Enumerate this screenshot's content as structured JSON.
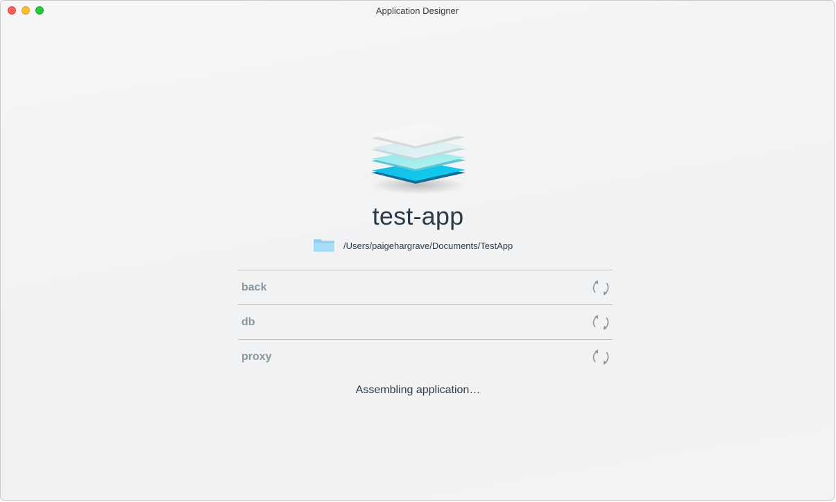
{
  "window": {
    "title": "Application Designer"
  },
  "app": {
    "name": "test-app",
    "path": "/Users/paigehargrave/Documents/TestApp",
    "icon": "layers-stack-icon",
    "folder_icon": "folder-icon"
  },
  "services": [
    {
      "name": "back",
      "icon": "refresh-icon"
    },
    {
      "name": "db",
      "icon": "refresh-icon"
    },
    {
      "name": "proxy",
      "icon": "refresh-icon"
    }
  ],
  "status": {
    "message": "Assembling application…"
  },
  "colors": {
    "close": "#fc5f57",
    "minimize": "#fdbc2e",
    "maximize": "#28c840",
    "text_primary": "#2d3b4a",
    "text_muted": "#8a979f",
    "accent_cyan": "#22c6e8",
    "folder_blue": "#8fd0f5"
  }
}
